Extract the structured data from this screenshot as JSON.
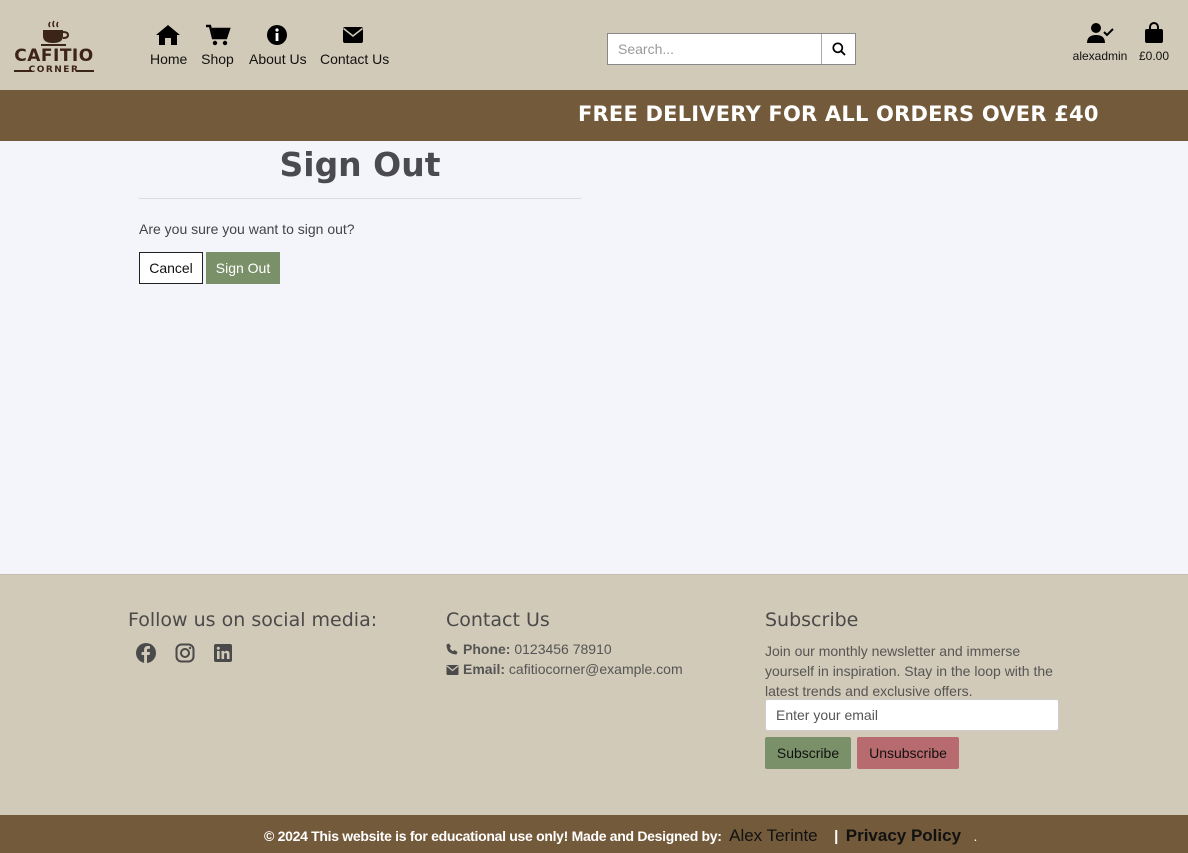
{
  "header": {
    "logo": {
      "brand": "CAFITIO",
      "sub": "CORNER"
    },
    "nav": [
      {
        "label": "Home",
        "icon": "home-icon"
      },
      {
        "label": "Shop",
        "icon": "cart-icon"
      },
      {
        "label": "About Us",
        "icon": "info-icon"
      },
      {
        "label": "Contact Us",
        "icon": "envelope-icon"
      }
    ],
    "search": {
      "placeholder": "Search...",
      "icon": "search-icon"
    },
    "account": {
      "label": "alexadmin",
      "icon": "user-check-icon"
    },
    "bag": {
      "label": "£0.00",
      "icon": "shopping-bag-icon"
    }
  },
  "banner": {
    "text": "FREE DELIVERY FOR ALL ORDERS OVER £40"
  },
  "main": {
    "title": "Sign Out",
    "question": "Are you sure you want to sign out?",
    "cancel_label": "Cancel",
    "signout_label": "Sign Out"
  },
  "footer": {
    "social_title": "Follow us on social media:",
    "social_icons": [
      "facebook-icon",
      "instagram-icon",
      "linkedin-icon"
    ],
    "contact_title": "Contact Us",
    "phone_label": "Phone:",
    "phone_value": "0123456 78910",
    "email_label": "Email:",
    "email_value": "cafitiocorner@example.com",
    "subscribe_title": "Subscribe",
    "subscribe_text": "Join our monthly newsletter and immerse yourself in inspiration. Stay in the loop with the latest trends and exclusive offers.",
    "email_placeholder": "Enter your email",
    "subscribe_label": "Subscribe",
    "unsubscribe_label": "Unsubscribe"
  },
  "bottom": {
    "copyright": "© 2024 This website is for educational use only! Made and Designed by:",
    "author": "Alex Terinte",
    "separator": "|",
    "privacy": "Privacy Policy",
    "end": "."
  },
  "colors": {
    "header_bg": "#d2cab8",
    "banner_bg": "#735a3a",
    "page_bg": "#f4f5fb",
    "green_button": "#7a9068",
    "red_button": "#b86b6f"
  }
}
